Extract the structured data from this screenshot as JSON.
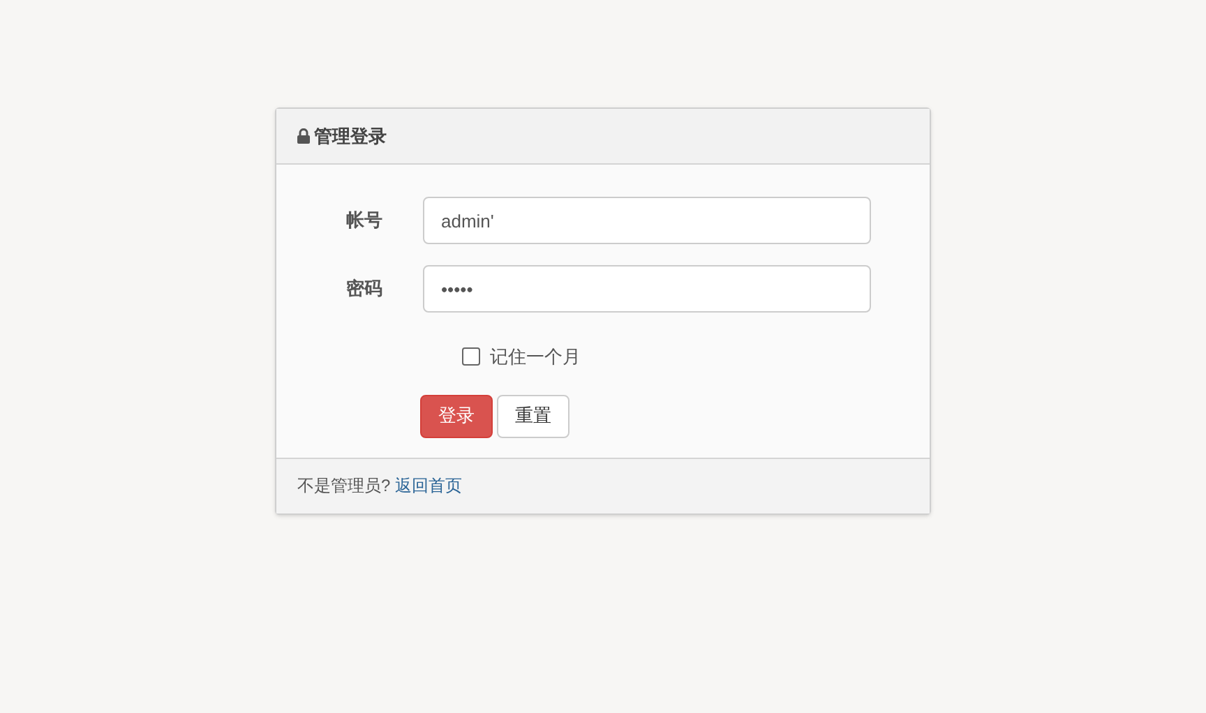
{
  "panel": {
    "title": "管理登录"
  },
  "fields": [
    {
      "label": "帐号",
      "value": "admin'"
    },
    {
      "label": "密码",
      "value": "•••••"
    }
  ],
  "remember": {
    "label": "记住一个月",
    "checked": false
  },
  "buttons": [
    {
      "label": "登录",
      "kind": "primary"
    },
    {
      "label": "重置",
      "kind": "default"
    }
  ],
  "footer": {
    "text": "不是管理员? ",
    "link": "返回首页"
  }
}
